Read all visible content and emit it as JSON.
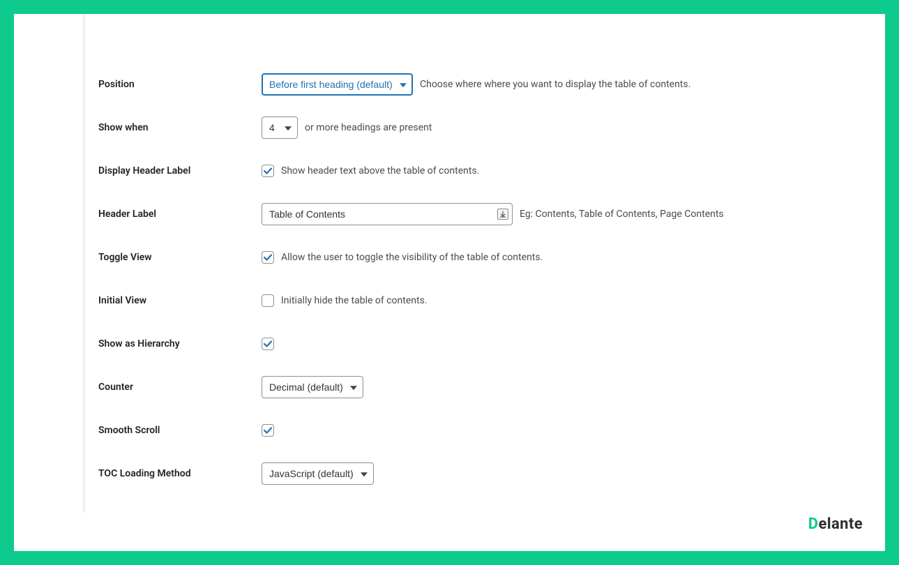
{
  "fields": {
    "position": {
      "label": "Position",
      "value": "Before first heading (default)",
      "help": "Choose where where you want to display the table of contents."
    },
    "show_when": {
      "label": "Show when",
      "value": "4",
      "suffix": "or more headings are present"
    },
    "display_header_label": {
      "label": "Display Header Label",
      "checkbox_text": "Show header text above the table of contents.",
      "checked": true
    },
    "header_label": {
      "label": "Header Label",
      "value": "Table of Contents",
      "help": "Eg: Contents, Table of Contents, Page Contents"
    },
    "toggle_view": {
      "label": "Toggle View",
      "checkbox_text": "Allow the user to toggle the visibility of the table of contents.",
      "checked": true
    },
    "initial_view": {
      "label": "Initial View",
      "checkbox_text": "Initially hide the table of contents.",
      "checked": false
    },
    "show_hierarchy": {
      "label": "Show as Hierarchy",
      "checked": true
    },
    "counter": {
      "label": "Counter",
      "value": "Decimal (default)"
    },
    "smooth_scroll": {
      "label": "Smooth Scroll",
      "checked": true
    },
    "toc_loading": {
      "label": "TOC Loading Method",
      "value": "JavaScript (default)"
    }
  },
  "logo": {
    "d": "D",
    "rest": "elante"
  }
}
